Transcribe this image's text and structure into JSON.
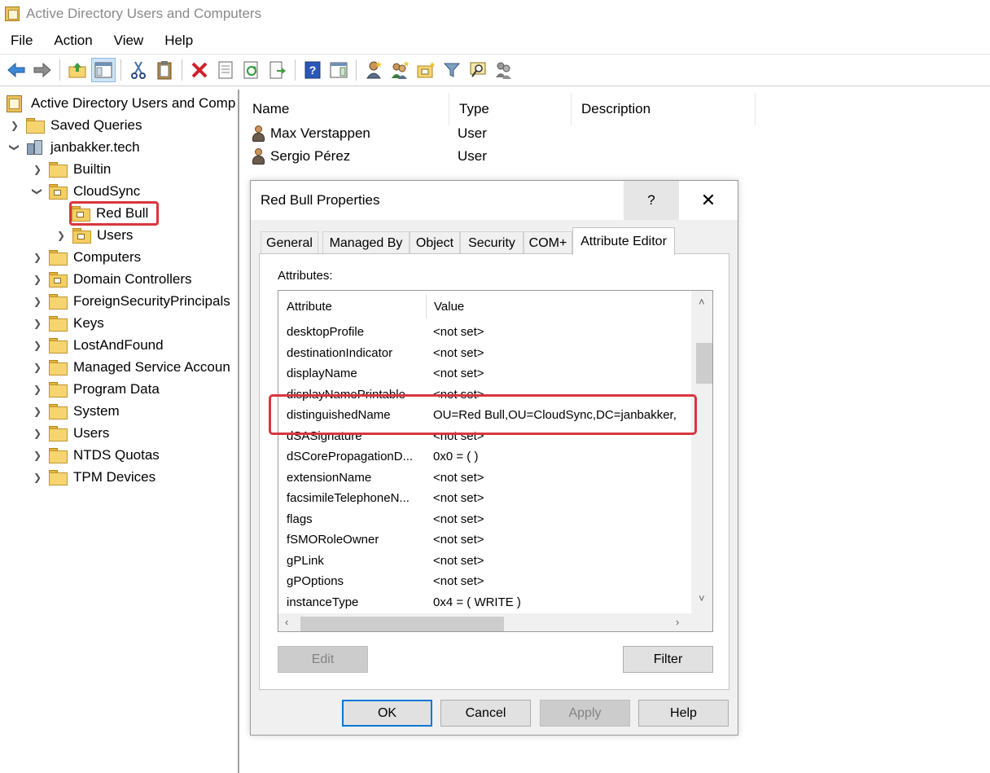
{
  "window": {
    "title": "Active Directory Users and Computers"
  },
  "menu": [
    "File",
    "Action",
    "View",
    "Help"
  ],
  "toolbar": {
    "icons": [
      "back-arrow-icon",
      "forward-arrow-icon",
      "up-folder-icon",
      "show-hide-console-tree-icon",
      "cut-icon",
      "clipboard-icon",
      "delete-icon",
      "properties-icon",
      "refresh-icon",
      "export-list-icon",
      "help-icon",
      "action-pane-icon",
      "new-user-icon",
      "new-group-icon",
      "new-ou-icon",
      "filter-icon",
      "find-icon",
      "add-to-group-icon"
    ]
  },
  "tree": {
    "root": "Active Directory Users and Comp",
    "saved_queries": "Saved Queries",
    "domain": "janbakker.tech",
    "items": {
      "builtin": "Builtin",
      "cloudsync": "CloudSync",
      "red_bull": "Red Bull",
      "users_ou": "Users",
      "computers": "Computers",
      "domain_controllers": "Domain Controllers",
      "fsp": "ForeignSecurityPrincipals",
      "keys": "Keys",
      "lost_and_found": "LostAndFound",
      "msa": "Managed Service Accoun",
      "program_data": "Program Data",
      "system": "System",
      "users": "Users",
      "ntds_quotas": "NTDS Quotas",
      "tpm_devices": "TPM Devices"
    }
  },
  "list": {
    "headers": {
      "name": "Name",
      "type": "Type",
      "description": "Description"
    },
    "rows": [
      {
        "name": "Max Verstappen",
        "type": "User"
      },
      {
        "name": "Sergio Pérez",
        "type": "User"
      }
    ]
  },
  "dialog": {
    "title": "Red Bull Properties",
    "help": "?",
    "close": "✕",
    "tabs": [
      "General",
      "Managed By",
      "Object",
      "Security",
      "COM+",
      "Attribute Editor"
    ],
    "active_tab": "Attribute Editor",
    "attributes_label": "Attributes:",
    "columns": {
      "attribute": "Attribute",
      "value": "Value"
    },
    "rows": [
      {
        "attribute": "desktopProfile",
        "value": "<not set>"
      },
      {
        "attribute": "destinationIndicator",
        "value": "<not set>"
      },
      {
        "attribute": "displayName",
        "value": "<not set>"
      },
      {
        "attribute": "displayNamePrintable",
        "value": "<not set>"
      },
      {
        "attribute": "distinguishedName",
        "value": "OU=Red Bull,OU=CloudSync,DC=janbakker,"
      },
      {
        "attribute": "dSASignature",
        "value": "<not set>"
      },
      {
        "attribute": "dSCorePropagationD...",
        "value": "0x0 = ( )"
      },
      {
        "attribute": "extensionName",
        "value": "<not set>"
      },
      {
        "attribute": "facsimileTelephoneN...",
        "value": "<not set>"
      },
      {
        "attribute": "flags",
        "value": "<not set>"
      },
      {
        "attribute": "fSMORoleOwner",
        "value": "<not set>"
      },
      {
        "attribute": "gPLink",
        "value": "<not set>"
      },
      {
        "attribute": "gPOptions",
        "value": "<not set>"
      },
      {
        "attribute": "instanceType",
        "value": "0x4 = ( WRITE )"
      }
    ],
    "buttons": {
      "edit": "Edit",
      "filter": "Filter",
      "ok": "OK",
      "cancel": "Cancel",
      "apply": "Apply",
      "help": "Help"
    }
  },
  "colors": {
    "highlight": "#d9363e",
    "dialog_bg": "#f0f0f0",
    "default_button_border": "#0078d7"
  }
}
